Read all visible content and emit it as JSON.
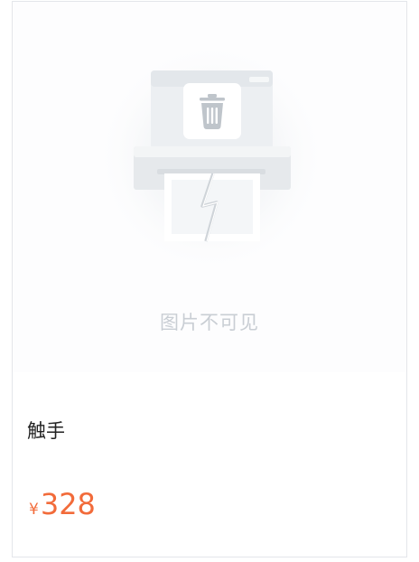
{
  "image": {
    "placeholder_text": "图片不可见",
    "icon": "broken-printer-trash-icon"
  },
  "product": {
    "name": "触手",
    "price_currency": "¥",
    "price_amount": "328"
  },
  "colors": {
    "price": "#f26b3a",
    "placeholder_text": "#c9ced4",
    "border": "#e4e6ea"
  }
}
